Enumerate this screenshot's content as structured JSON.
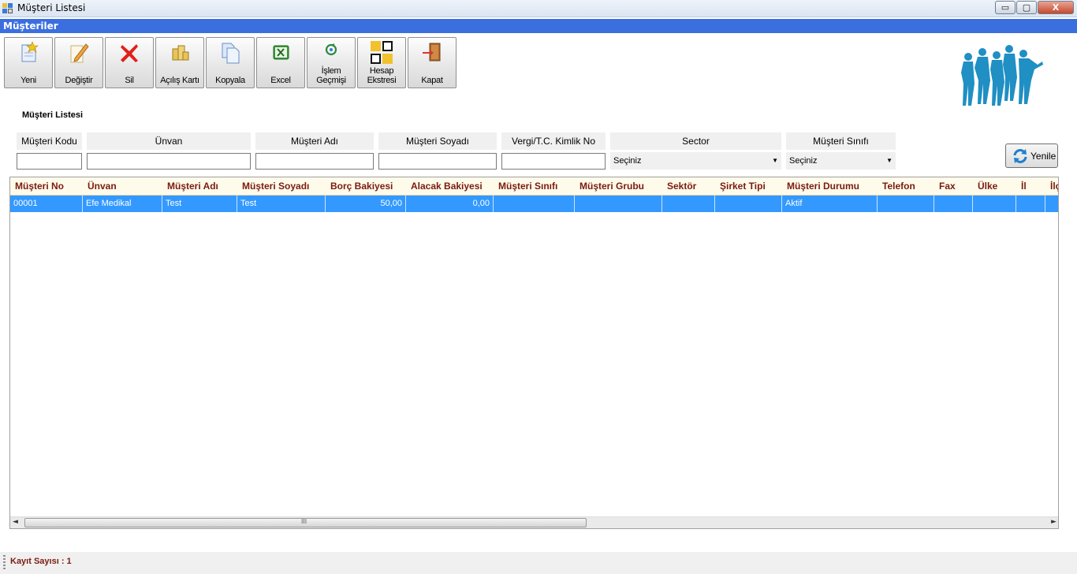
{
  "window": {
    "title": "Müşteri Listesi",
    "controls": {
      "minimize": "▭",
      "maximize": "▢",
      "close": "X"
    }
  },
  "header": {
    "title": "Müşteriler"
  },
  "toolbar": [
    {
      "name": "yeni",
      "label": "Yeni",
      "icon": "new-document-star-icon"
    },
    {
      "name": "degistir",
      "label": "Değiştir",
      "icon": "edit-pencil-icon"
    },
    {
      "name": "sil",
      "label": "Sil",
      "icon": "delete-x-icon"
    },
    {
      "name": "acilis-karti",
      "label": "Açılış Kartı",
      "icon": "coins-icon"
    },
    {
      "name": "kopyala",
      "label": "Kopyala",
      "icon": "copy-icon"
    },
    {
      "name": "excel",
      "label": "Excel",
      "icon": "excel-icon"
    },
    {
      "name": "islem-gecmisi",
      "label": "İşlem\nGeçmişi",
      "icon": "history-icon"
    },
    {
      "name": "hesap-ekstresi",
      "label": "Hesap\nEkstresi",
      "icon": "squares-icon"
    },
    {
      "name": "kapat",
      "label": "Kapat",
      "icon": "exit-door-icon"
    }
  ],
  "section_title": "Müşteri Listesi",
  "filters": {
    "musteri_kodu": {
      "label": "Müşteri Kodu",
      "value": ""
    },
    "unvan": {
      "label": "Ünvan",
      "value": ""
    },
    "musteri_adi": {
      "label": "Müşteri Adı",
      "value": ""
    },
    "musteri_soyadi": {
      "label": "Müşteri Soyadı",
      "value": ""
    },
    "vergi_no": {
      "label": "Vergi/T.C. Kimlik No",
      "value": ""
    },
    "sector": {
      "label": "Sector",
      "selected": "Seçiniz"
    },
    "musteri_sinifi": {
      "label": "Müşteri Sınıfı",
      "selected": "Seçiniz"
    }
  },
  "refresh_label": "Yenile",
  "grid": {
    "columns": [
      "Müşteri No",
      "Ünvan",
      "Müşteri Adı",
      "Müşteri Soyadı",
      "Borç Bakiyesi",
      "Alacak Bakiyesi",
      "Müşteri Sınıfı",
      "Müşteri Grubu",
      "Sektör",
      "Şirket Tipi",
      "Müşteri Durumu",
      "Telefon",
      "Fax",
      "Ülke",
      "İl",
      "İlç"
    ],
    "rows": [
      [
        "00001",
        "Efe Medikal",
        "Test",
        "Test",
        "50,00",
        "0,00",
        "",
        "",
        "",
        "",
        "Aktif",
        "",
        "",
        "",
        "",
        ""
      ]
    ],
    "selected_row": 0,
    "scroll_grip": "III"
  },
  "status": {
    "count_text": "Kayıt Sayısı : 1"
  },
  "colors": {
    "header_bar": "#3b6fe0",
    "selected_row": "#3399ff",
    "column_header_text": "#7a1b0f"
  }
}
